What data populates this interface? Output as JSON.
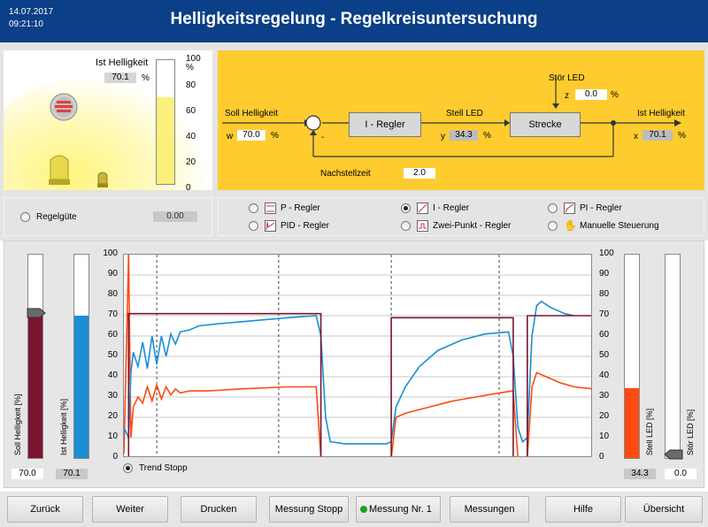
{
  "header": {
    "date": "14.07.2017",
    "time": "09:21:10",
    "title": "Helligkeitsregelung - Regelkreisuntersuchung"
  },
  "scene": {
    "ist_label": "Ist Helligkeit",
    "ist_value": "70.1",
    "unit": "%",
    "gauge_fill": 0.701,
    "gauge_ticks": [
      "100",
      "%",
      "80",
      "60",
      "40",
      "20",
      "0"
    ]
  },
  "block": {
    "soll_label": "Soll Helligkeit",
    "w_label": "w",
    "w_value": "70.0",
    "unit": "%",
    "regler_label": "I - Regler",
    "stell_label": "Stell LED",
    "y_label": "y",
    "y_value": "34.3",
    "strecke_label": "Strecke",
    "stoer_label": "Stör LED",
    "z_label": "z",
    "z_value": "0.0",
    "ist_label": "Ist Helligkeit",
    "x_label": "x",
    "x_value": "70.1",
    "nachstell_label": "Nachstellzeit",
    "nachstell_value": "2.0",
    "minus": "-"
  },
  "quality": {
    "label": "Regelgüte",
    "value": "0.00"
  },
  "modes": [
    {
      "label": "P - Regler",
      "selected": false
    },
    {
      "label": "I - Regler",
      "selected": true
    },
    {
      "label": "PI - Regler",
      "selected": false
    },
    {
      "label": "PID - Regler",
      "selected": false
    },
    {
      "label": "Zwei-Punkt - Regler",
      "selected": false
    },
    {
      "label": "Manuelle Steuerung",
      "selected": false
    }
  ],
  "trend": {
    "left_bars": {
      "soll_label": "Soll Helligkeit [%]",
      "soll_value": "70.0",
      "ist_label": "Ist Helligkeit [%]",
      "ist_value": "70.1"
    },
    "right_bars": {
      "stell_label": "Stell LED [%]",
      "stell_value": "34.3",
      "stoer_label": "Stör LED [%]",
      "stoer_value": "0.0"
    },
    "trend_stop_label": "Trend Stopp",
    "colors": {
      "soll": "#7a1530",
      "ist": "#1a8fd6",
      "stell": "#ff4a12",
      "stoer": "#f08a00"
    }
  },
  "chart_data": {
    "type": "line",
    "y_ticks": [
      "100",
      "90",
      "80",
      "70",
      "60",
      "50",
      "40",
      "30",
      "20",
      "10",
      "0"
    ],
    "ylim": [
      0,
      100
    ],
    "x_range": [
      0,
      100
    ],
    "grid": true,
    "series": [
      {
        "name": "Soll Helligkeit",
        "color": "#7a1530",
        "points": [
          [
            0,
            0
          ],
          [
            1,
            0
          ],
          [
            1,
            71
          ],
          [
            42,
            71
          ],
          [
            42,
            0
          ],
          [
            57,
            0
          ],
          [
            57,
            69
          ],
          [
            83,
            69
          ],
          [
            83,
            0
          ],
          [
            86,
            0
          ],
          [
            86,
            70
          ],
          [
            100,
            70
          ]
        ]
      },
      {
        "name": "Ist Helligkeit",
        "color": "#1a8fd6",
        "points": [
          [
            0,
            15
          ],
          [
            1,
            10
          ],
          [
            1.5,
            42
          ],
          [
            2,
            52
          ],
          [
            3,
            45
          ],
          [
            4,
            57
          ],
          [
            5,
            44
          ],
          [
            6,
            60
          ],
          [
            7,
            46
          ],
          [
            8,
            60
          ],
          [
            9,
            50
          ],
          [
            10,
            61
          ],
          [
            11,
            56
          ],
          [
            12,
            62
          ],
          [
            14,
            63
          ],
          [
            16,
            65
          ],
          [
            20,
            66
          ],
          [
            25,
            67
          ],
          [
            30,
            68
          ],
          [
            35,
            69
          ],
          [
            41,
            70
          ],
          [
            42,
            60
          ],
          [
            43,
            20
          ],
          [
            44,
            8
          ],
          [
            47,
            7
          ],
          [
            52,
            7
          ],
          [
            56,
            7
          ],
          [
            57,
            8
          ],
          [
            58,
            25
          ],
          [
            60,
            35
          ],
          [
            63,
            45
          ],
          [
            67,
            53
          ],
          [
            72,
            58
          ],
          [
            77,
            61
          ],
          [
            82,
            62
          ],
          [
            83,
            50
          ],
          [
            84,
            15
          ],
          [
            85,
            8
          ],
          [
            86,
            10
          ],
          [
            87,
            60
          ],
          [
            88,
            75
          ],
          [
            89,
            77
          ],
          [
            91,
            74
          ],
          [
            94,
            71
          ],
          [
            96,
            70
          ]
        ]
      },
      {
        "name": "Stell LED",
        "color": "#ff4a12",
        "points": [
          [
            0,
            2
          ],
          [
            1,
            100
          ],
          [
            1.5,
            10
          ],
          [
            2,
            25
          ],
          [
            3,
            30
          ],
          [
            4,
            27
          ],
          [
            5,
            35
          ],
          [
            6,
            28
          ],
          [
            7,
            36
          ],
          [
            8,
            29
          ],
          [
            9,
            35
          ],
          [
            10,
            31
          ],
          [
            11,
            34
          ],
          [
            12,
            32
          ],
          [
            14,
            33
          ],
          [
            18,
            33
          ],
          [
            25,
            34
          ],
          [
            35,
            35
          ],
          [
            41,
            35
          ],
          [
            42,
            0
          ],
          [
            57,
            0
          ],
          [
            58,
            20
          ],
          [
            60,
            22
          ],
          [
            65,
            25
          ],
          [
            70,
            28
          ],
          [
            75,
            30
          ],
          [
            80,
            32
          ],
          [
            83,
            33
          ],
          [
            84,
            0
          ],
          [
            86,
            0
          ],
          [
            87,
            35
          ],
          [
            88,
            42
          ],
          [
            90,
            40
          ],
          [
            93,
            37
          ],
          [
            96,
            35
          ],
          [
            100,
            34
          ]
        ]
      },
      {
        "name": "Stör LED",
        "color": "#f08a00",
        "points": [
          [
            0,
            0
          ],
          [
            100,
            0
          ]
        ]
      }
    ]
  },
  "buttons": [
    {
      "label": "Zurück"
    },
    {
      "label": "Weiter"
    },
    {
      "label": "Drucken"
    },
    {
      "label": "Messung Stopp"
    },
    {
      "label": "Messung Nr. 1"
    },
    {
      "label": "Messungen"
    },
    {
      "label": "Hilfe"
    },
    {
      "label": "Übersicht"
    }
  ]
}
